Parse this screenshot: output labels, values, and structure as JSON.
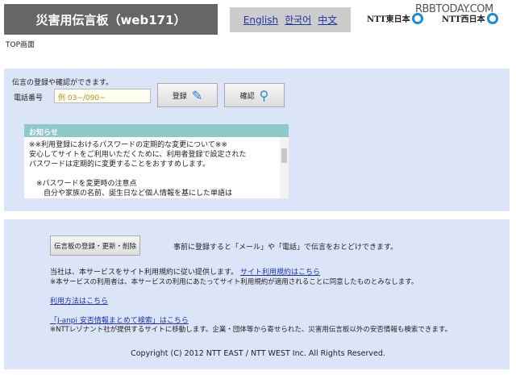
{
  "header": {
    "title": "災害用伝言板（web171）",
    "languages": [
      "English",
      "한국어",
      "中文"
    ],
    "logos": [
      "NTT東日本",
      "NTT西日本"
    ],
    "watermark": "RBBTODAY.COM"
  },
  "breadcrumb": "TOP画面",
  "main": {
    "intro": "伝言の登録や確認ができます。",
    "phone_label": "電話番号",
    "phone_placeholder": "例 03~/090~",
    "register_label": "登録",
    "confirm_label": "確認"
  },
  "notice": {
    "title": "お知らせ",
    "lines": [
      "※※利用登録におけるパスワードの定期的な変更について※※",
      "安心してサイトをご利用いただくために、利用者登録で設定された",
      "パスワードは定期的に変更することをおすすめします。",
      "",
      "　※パスワードを変更時の注意点",
      "　　自分や家族の名前、誕生日など個人情報を基にした単語は"
    ]
  },
  "footer": {
    "manage_button": "伝言板の登録・更新・削除",
    "manage_desc": "事前に登録すると「メール」や「電話」で伝言をおとどけできます。",
    "terms_text": "当社は、本サービスをサイト利用規約に従い提供します。",
    "terms_link": "サイト利用規約はこちら",
    "terms_note": "※本サービスの利用者は、本サービスの利用にあたってサイト利用規約が適用されることに同意したものとみなします。",
    "usage_link": "利用方法はこちら",
    "janpi_link": "「J-anpi 安否情報まとめて検索」はこちら",
    "janpi_note": "※NTTレゾナント社が提供するサイトに移動します。企業・団体等から寄せられた、災害用伝言板以外の安否情報も検索できます。",
    "copyright": "Copyright (C) 2012 NTT EAST / NTT WEST Inc. All Rights Reserved."
  }
}
